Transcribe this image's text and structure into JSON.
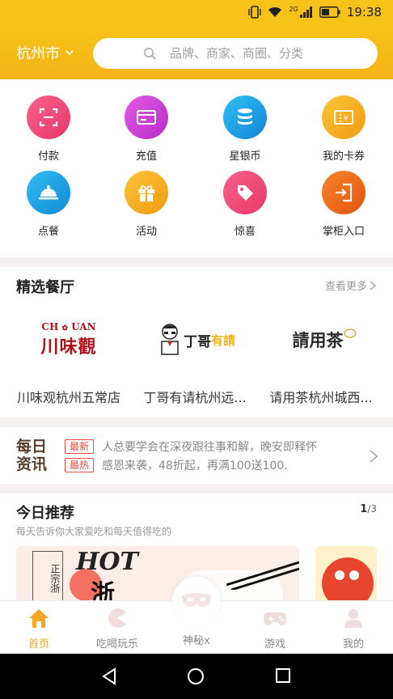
{
  "status_bar": {
    "network": "2G",
    "time": "19:38"
  },
  "header": {
    "city": "杭州市",
    "search_placeholder": "品牌、商家、商圈、分类"
  },
  "quick_menu": [
    {
      "label": "付款",
      "icon": "scan-icon",
      "color": "#f0507a"
    },
    {
      "label": "充值",
      "icon": "card-icon",
      "color": "#d43ad6"
    },
    {
      "label": "星银币",
      "icon": "coins-icon",
      "color": "#1fa6e8"
    },
    {
      "label": "我的卡券",
      "icon": "ticket-icon",
      "color": "#f7b21c"
    },
    {
      "label": "点餐",
      "icon": "dish-cover-icon",
      "color": "#20a8e2"
    },
    {
      "label": "活动",
      "icon": "gift-icon",
      "color": "#f7b21c"
    },
    {
      "label": "惊喜",
      "icon": "tag-icon",
      "color": "#f0507a"
    },
    {
      "label": "掌柜入口",
      "icon": "door-enter-icon",
      "color": "#f26a1b"
    }
  ],
  "featured": {
    "title": "精选餐厅",
    "more": "查看更多",
    "restaurants": [
      {
        "name": "川味观杭州五常店",
        "logo_top": "CH",
        "logo_top2": "UAN",
        "logo_main": "川味觀"
      },
      {
        "name": "丁哥有请杭州远...",
        "logo_main": "丁哥",
        "logo_accent": "有請"
      },
      {
        "name": "请用茶杭州城西...",
        "logo_main": "請用茶"
      }
    ]
  },
  "daily_news": {
    "logo_line1": "每日",
    "logo_line2": "资讯",
    "items": [
      {
        "tag": "最新",
        "text": "人总要学会在深夜跟往事和解，晚安即释怀"
      },
      {
        "tag": "最热",
        "text": "感恩来袭，48折起，再满100送100."
      }
    ]
  },
  "recommend": {
    "title": "今日推荐",
    "subtitle": "每天告诉你大家爱吃和每天值得吃的",
    "page_current": "1",
    "page_total": "/3",
    "banner_text": "HOT",
    "banner_text2": "浙",
    "banner_side": "正宗浙"
  },
  "tabbar": [
    {
      "label": "首页",
      "icon": "home-icon",
      "active": true
    },
    {
      "label": "吃喝玩乐",
      "icon": "pacman-icon",
      "active": false
    },
    {
      "label": "神秘x",
      "icon": "mask-icon",
      "active": false
    },
    {
      "label": "游戏",
      "icon": "gamepad-icon",
      "active": false
    },
    {
      "label": "我的",
      "icon": "user-icon",
      "active": false
    }
  ],
  "colors": {
    "brand": "#f7c21a",
    "active_tab": "#f5a623",
    "news_tag": "#e74c3c"
  }
}
